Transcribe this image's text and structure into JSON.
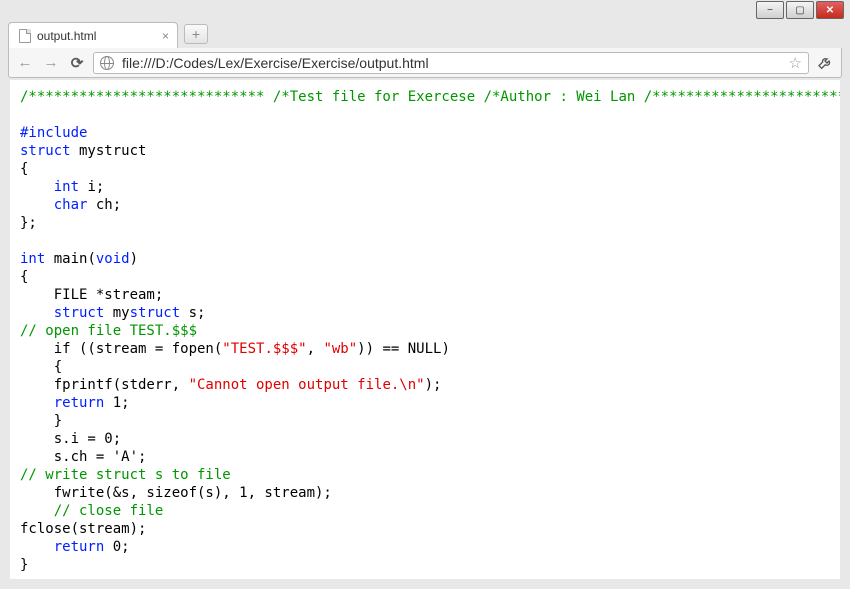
{
  "window": {
    "buttons": {
      "minimize": "−",
      "maximize": "▢",
      "close": "✕"
    }
  },
  "tab": {
    "title": "output.html",
    "close_glyph": "×"
  },
  "toolbar": {
    "back_glyph": "←",
    "forward_glyph": "→",
    "reload_glyph": "⟳",
    "newtab_glyph": "+",
    "star_glyph": "☆",
    "url": "file:///D:/Codes/Lex/Exercise/Exercise/output.html"
  },
  "code": {
    "header_comment": "/**************************** /*Test file for Exercese /*Author : Wei Lan /*****************************/",
    "blank": "",
    "include": "#include",
    "kw_struct": "struct",
    "kw_int": "int",
    "kw_char": "char",
    "kw_void": "void",
    "kw_return": "return",
    "kw_if": "if",
    "mystruct_name": " mystruct",
    "brace_open": "{",
    "brace_close": "}",
    "brace_close_semi": "};",
    "indent": "    ",
    "i_decl": " i;",
    "ch_decl": " ch;",
    "main_sig_post": " main(",
    "kw_void_only": "void",
    "main_sig_close": ")",
    "file_decl": "FILE *stream;",
    "s_decl_post": " s;",
    "open_file_comment": "// open file TEST.$$$",
    "if_open": "    if ((stream = fopen(",
    "str_test": "\"TEST.$$$\"",
    "comma": ", ",
    "str_wb": "\"wb\"",
    "if_close": ")) == NULL)",
    "brace_open_ind": "    {",
    "fprintf_pre": "    fprintf(stderr, ",
    "str_cannot": "\"Cannot open output file.\\n\"",
    "fprintf_post": ");",
    "return1": " 1;",
    "brace_close_ind": "    }",
    "si_line": "    s.i = 0;",
    "sch_line": "    s.ch = 'A';",
    "write_comment": "// write struct s to file",
    "fwrite_line": "    fwrite(&s, sizeof(s), 1, stream);",
    "close_comment": "    // close file",
    "fclose_line": "fclose(stream);",
    "return0": " 0;"
  }
}
